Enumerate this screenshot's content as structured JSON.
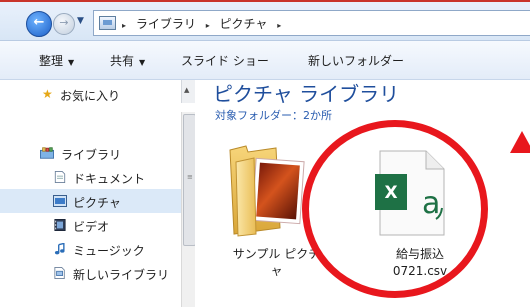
{
  "address_bar": {
    "crumbs": [
      "ライブラリ",
      "ピクチャ"
    ],
    "separator": "▸"
  },
  "toolbar": {
    "organize": "整理",
    "share": "共有",
    "slideshow": "スライド ショー",
    "new_folder": "新しいフォルダー",
    "dropdown_caret": "▼"
  },
  "nav_pane_top": {
    "favorites": "お気に入り"
  },
  "library_header": {
    "title": "ピクチャ ライブラリ",
    "arrange_partial": "対象フォルダー：2か所"
  },
  "sidebar": {
    "items": [
      {
        "label": "ライブラリ",
        "icon": "library-icon",
        "selected": false
      },
      {
        "label": "ドキュメント",
        "icon": "documents-icon",
        "selected": false
      },
      {
        "label": "ピクチャ",
        "icon": "pictures-icon",
        "selected": true
      },
      {
        "label": "ビデオ",
        "icon": "video-icon",
        "selected": false
      },
      {
        "label": "ミュージック",
        "icon": "music-icon",
        "selected": false
      },
      {
        "label": "新しいライブラリ",
        "icon": "new-library-icon",
        "selected": false
      }
    ]
  },
  "files": [
    {
      "line1": "サンプル ピクチ",
      "line2": "ャ",
      "icon": "folder-icon"
    },
    {
      "line1": "給与振込",
      "line2": "0721.csv",
      "icon": "excel-csv-icon"
    }
  ],
  "colors": {
    "highlight": "#e8171d",
    "heading": "#1f4e9c",
    "excel_green": "#1e7145",
    "selection": "#dbe9f8"
  }
}
